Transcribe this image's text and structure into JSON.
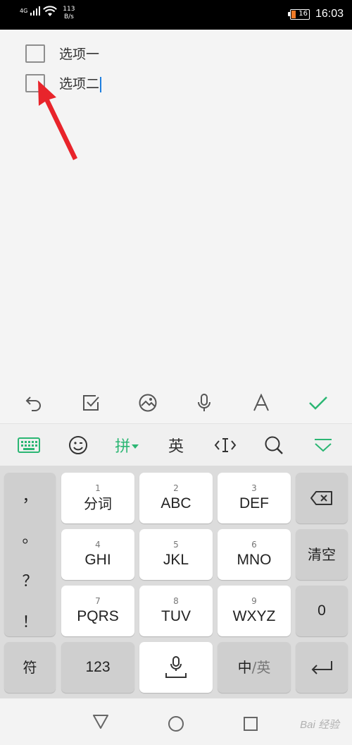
{
  "status_bar": {
    "network": "4G",
    "speed_value": "113",
    "speed_unit": "B/s",
    "battery_level": "16",
    "time": "16:03"
  },
  "editor": {
    "todos": [
      {
        "label": "选项一",
        "checked": false
      },
      {
        "label": "选项二",
        "checked": false
      }
    ]
  },
  "toolbar": {
    "icons": [
      "undo-icon",
      "checklist-icon",
      "image-icon",
      "microphone-icon",
      "text-format-icon",
      "confirm-check-icon"
    ]
  },
  "ime_bar": {
    "pinyin": "拼",
    "english": "英",
    "accent_color": "#2bb673"
  },
  "keyboard": {
    "punctuation": [
      "，",
      "。",
      "？",
      "！"
    ],
    "keys": [
      {
        "num": "1",
        "label": "分词"
      },
      {
        "num": "2",
        "label": "ABC"
      },
      {
        "num": "3",
        "label": "DEF"
      },
      {
        "num": "4",
        "label": "GHI"
      },
      {
        "num": "5",
        "label": "JKL"
      },
      {
        "num": "6",
        "label": "MNO"
      },
      {
        "num": "7",
        "label": "PQRS"
      },
      {
        "num": "8",
        "label": "TUV"
      },
      {
        "num": "9",
        "label": "WXYZ"
      }
    ],
    "clear": "清空",
    "zero": "0",
    "symbol": "符",
    "numeric": "123",
    "lang_zh": "中",
    "lang_sep": "/",
    "lang_en": "英"
  },
  "watermark": "Bai 经验"
}
